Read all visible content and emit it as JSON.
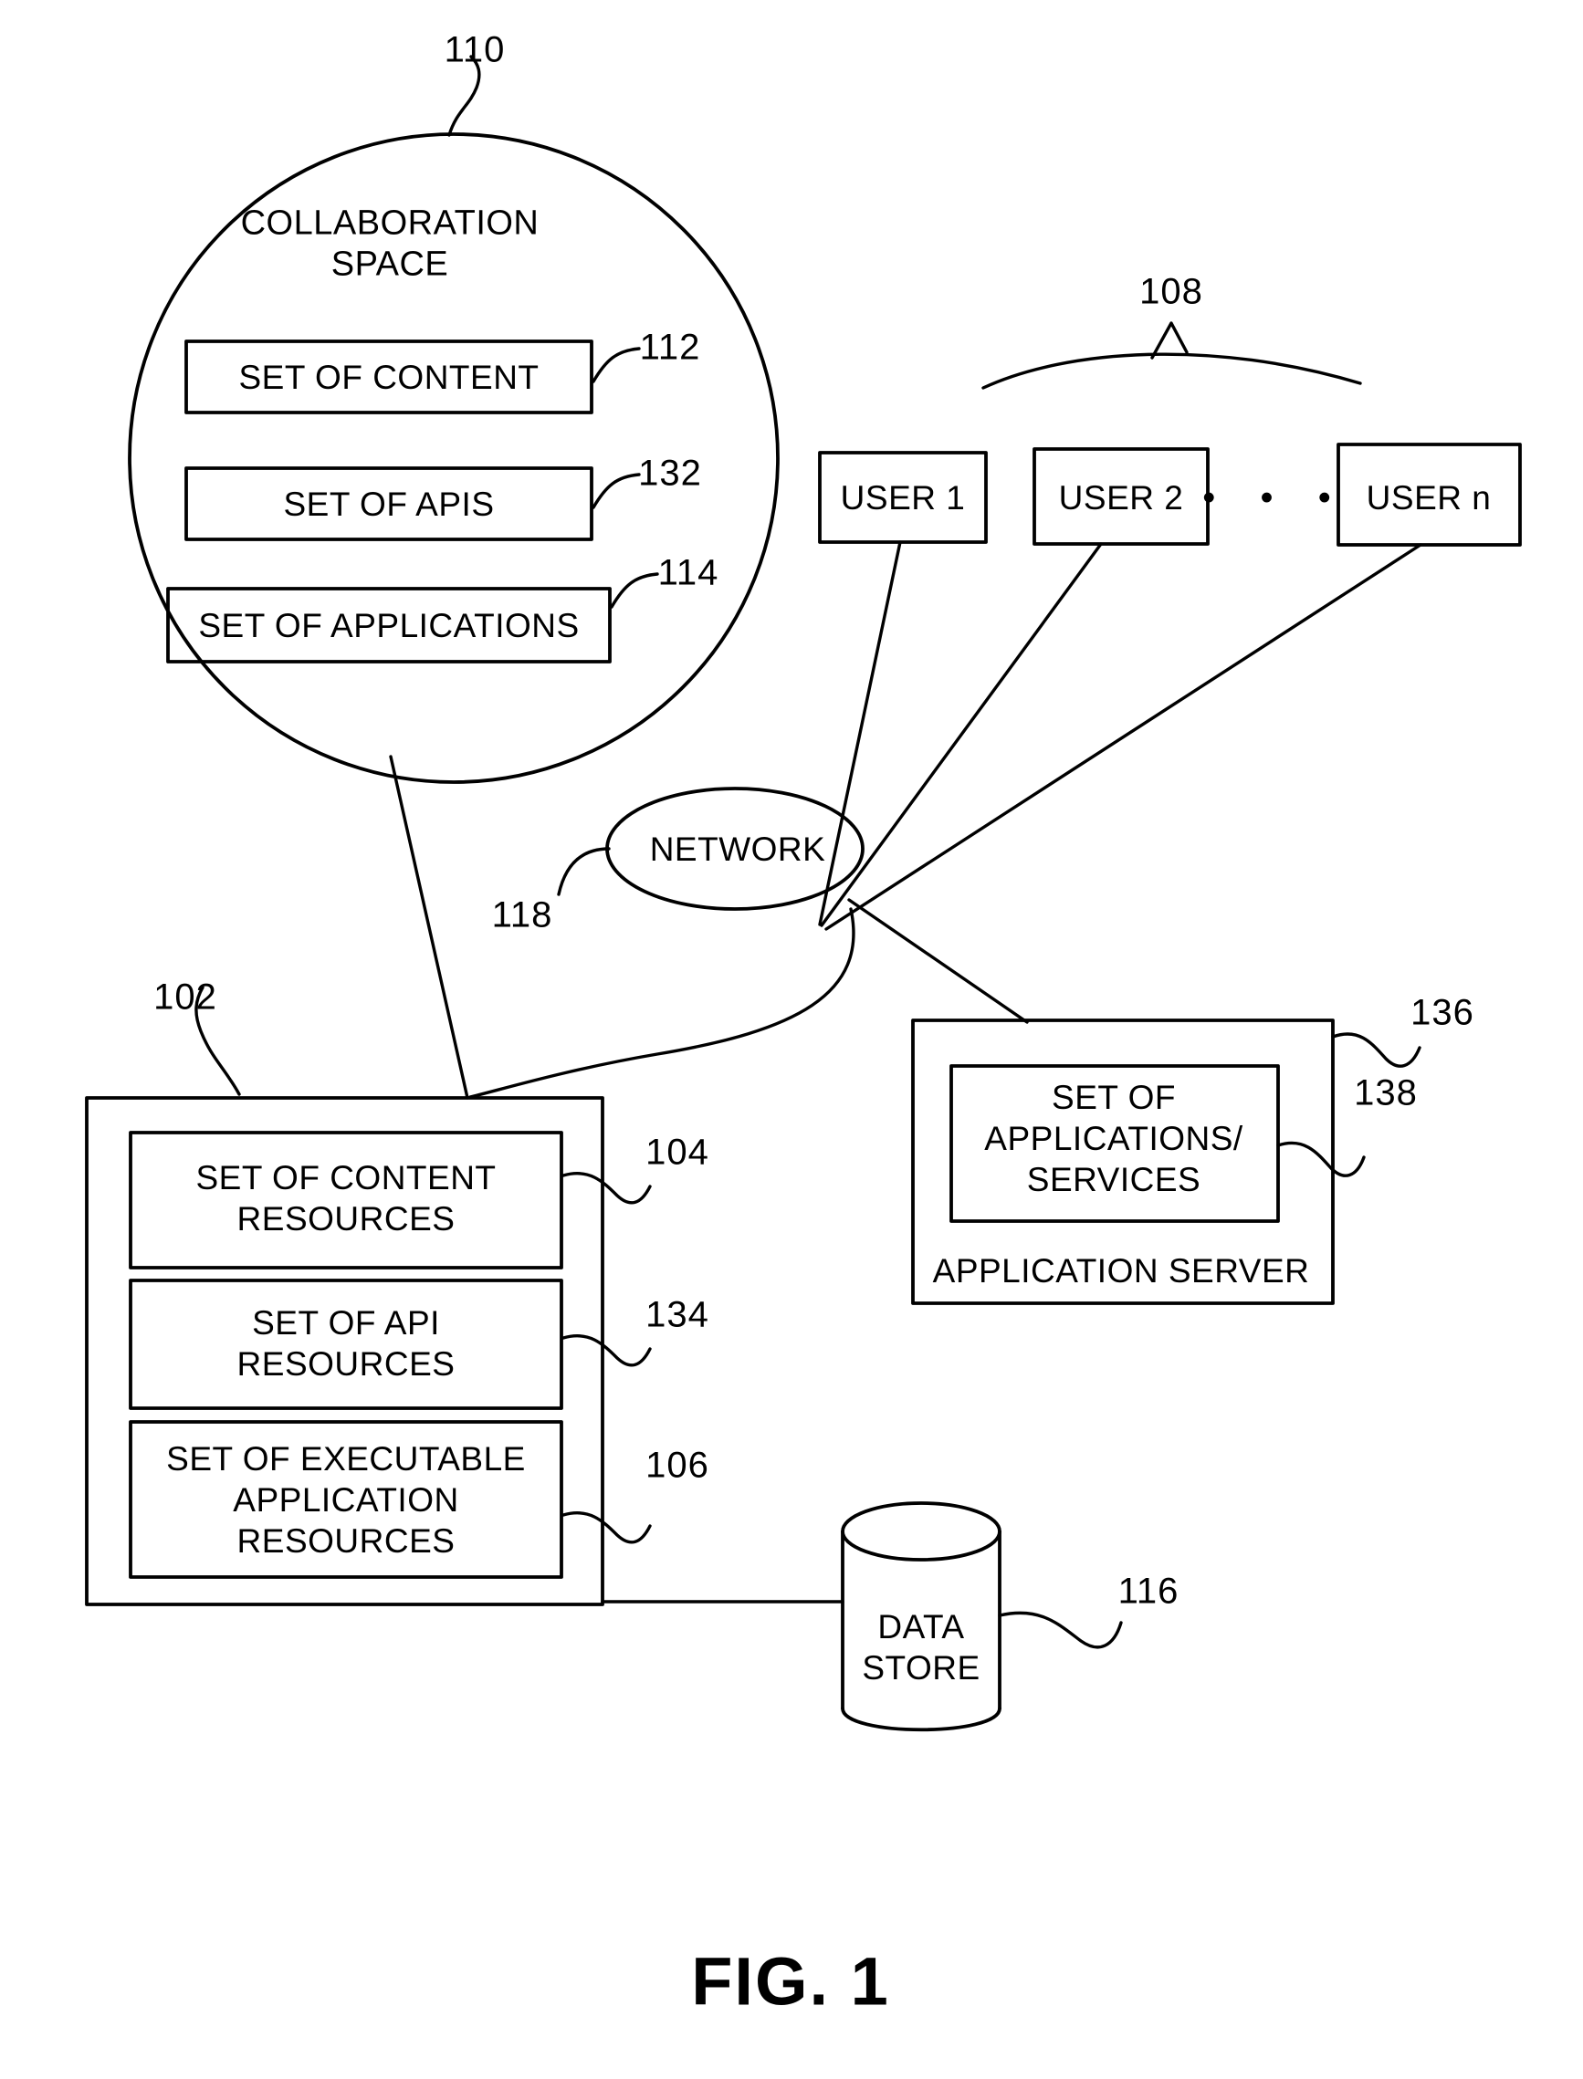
{
  "figure": {
    "caption": "FIG. 1"
  },
  "collaboration_space": {
    "title_line1": "COLLABORATION",
    "title_line2": "SPACE",
    "ref": "110",
    "boxes": [
      {
        "label": "SET OF CONTENT",
        "ref": "112"
      },
      {
        "label": "SET OF APIS",
        "ref": "132"
      },
      {
        "label": "SET OF APPLICATIONS",
        "ref": "114"
      }
    ]
  },
  "users": {
    "ref": "108",
    "items": [
      {
        "label": "USER 1"
      },
      {
        "label": "USER 2"
      },
      {
        "label": "USER n"
      }
    ],
    "ellipsis": "•  •  •"
  },
  "network": {
    "label": "NETWORK",
    "ref": "118"
  },
  "resource_system": {
    "ref": "102",
    "boxes": [
      {
        "line1": "SET OF CONTENT",
        "line2": "RESOURCES",
        "line3": "",
        "ref": "104"
      },
      {
        "line1": "SET OF API",
        "line2": "RESOURCES",
        "line3": "",
        "ref": "134"
      },
      {
        "line1": "SET OF EXECUTABLE",
        "line2": "APPLICATION",
        "line3": "RESOURCES",
        "ref": "106"
      }
    ]
  },
  "application_server": {
    "title": "APPLICATION SERVER",
    "ref": "136",
    "inner": {
      "line1": "SET OF",
      "line2": "APPLICATIONS/",
      "line3": "SERVICES",
      "ref": "138"
    }
  },
  "data_store": {
    "line1": "DATA",
    "line2": "STORE",
    "ref": "116"
  },
  "colors": {
    "ink": "#000000",
    "paper": "#ffffff"
  }
}
